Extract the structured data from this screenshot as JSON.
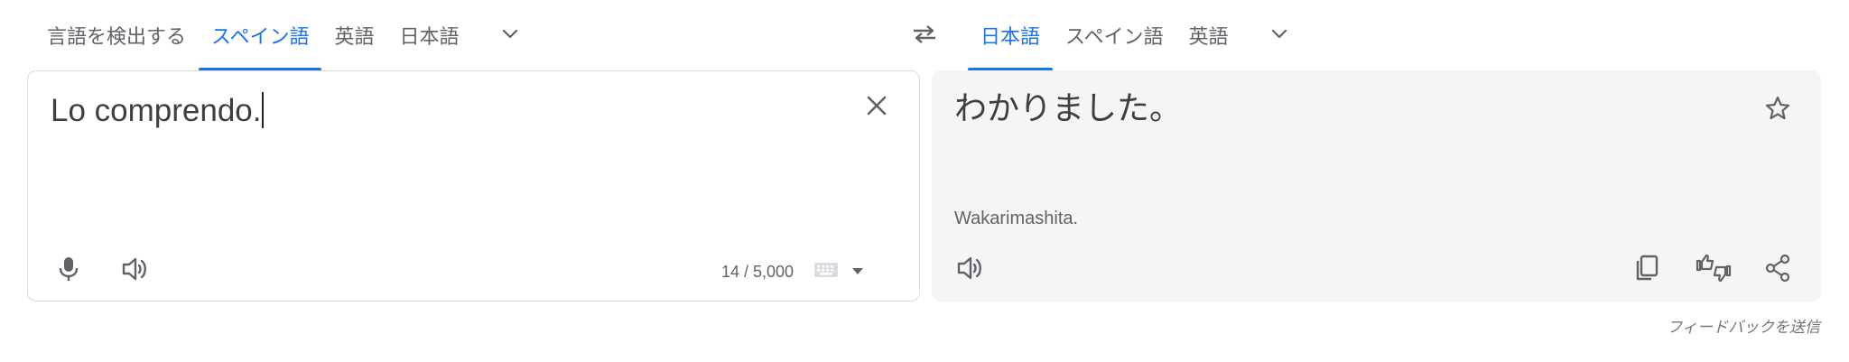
{
  "source_languages": {
    "tabs": [
      {
        "label": "言語を検出する",
        "active": false
      },
      {
        "label": "スペイン語",
        "active": true
      },
      {
        "label": "英語",
        "active": false
      },
      {
        "label": "日本語",
        "active": false
      }
    ],
    "more_icon": "chevron-down-icon"
  },
  "swap_icon": "swap-arrows-icon",
  "target_languages": {
    "tabs": [
      {
        "label": "日本語",
        "active": true
      },
      {
        "label": "スペイン語",
        "active": false
      },
      {
        "label": "英語",
        "active": false
      }
    ],
    "more_icon": "chevron-down-icon"
  },
  "source": {
    "text": "Lo comprendo.",
    "char_count": "14 / 5,000",
    "clear_icon": "close-icon",
    "mic_icon": "microphone-icon",
    "listen_icon": "speaker-icon",
    "keyboard_icon": "keyboard-icon",
    "keyboard_dropdown_icon": "caret-down-icon"
  },
  "target": {
    "text": "わかりました。",
    "romanization": "Wakarimashita.",
    "star_icon": "star-icon",
    "listen_icon": "speaker-icon",
    "copy_icon": "copy-icon",
    "rate_icon": "thumbs-up-down-icon",
    "share_icon": "share-icon"
  },
  "feedback": {
    "label": "フィードバックを送信"
  },
  "colors": {
    "accent": "#1a73e8",
    "text": "#3c4043",
    "secondary_text": "#5f6368",
    "panel_bg": "#f5f5f5",
    "border": "#dadce0"
  }
}
